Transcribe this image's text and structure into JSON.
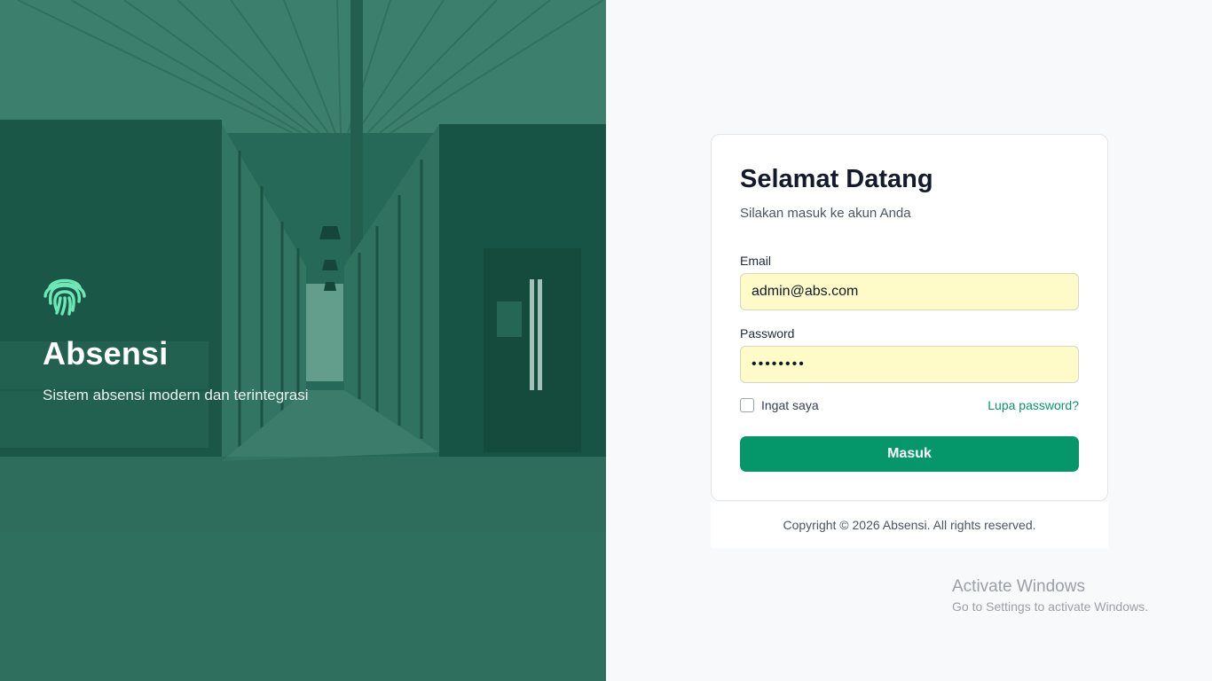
{
  "hero": {
    "logo_icon": "fingerprint-icon",
    "title": "Absensi",
    "subtitle": "Sistem absensi modern dan terintegrasi",
    "overlay_color": "#0f5e4a",
    "logo_color": "#6ee7b7"
  },
  "login": {
    "title": "Selamat Datang",
    "subtitle": "Silakan masuk ke akun Anda",
    "email_label": "Email",
    "email_value": "admin@abs.com",
    "password_label": "Password",
    "password_value": "admin123",
    "remember_label": "Ingat saya",
    "remember_checked": false,
    "forgot_label": "Lupa password?",
    "submit_label": "Masuk",
    "accent_color": "#059669"
  },
  "footer": {
    "copyright": "Copyright © 2026 Absensi. All rights reserved."
  },
  "os_watermark": {
    "title": "Activate Windows",
    "subtitle": "Go to Settings to activate Windows."
  }
}
